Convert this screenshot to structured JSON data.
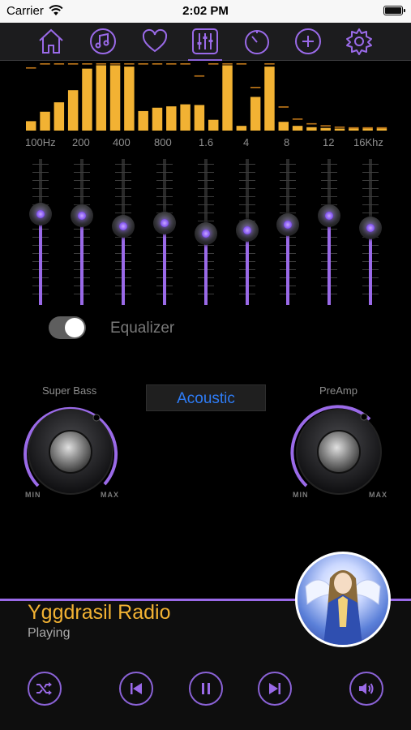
{
  "status_bar": {
    "carrier": "Carrier",
    "time": "2:02 PM"
  },
  "toolbar": {
    "icons": [
      "home-icon",
      "music-note-icon",
      "heart-icon",
      "equalizer-icon",
      "timer-icon",
      "add-icon",
      "gear-icon"
    ],
    "active": "equalizer-icon"
  },
  "spectrum": {
    "bar_levels": [
      0.14,
      0.28,
      0.42,
      0.6,
      0.92,
      0.97,
      0.97,
      0.95,
      0.29,
      0.34,
      0.36,
      0.39,
      0.38,
      0.16,
      0.97,
      0.07,
      0.5,
      0.95,
      0.13,
      0.07,
      0.05,
      0.04,
      0.03,
      0.03,
      0.03,
      0.03
    ],
    "peak_levels": [
      0.94,
      1.0,
      1.0,
      1.0,
      1.0,
      1.0,
      1.0,
      1.0,
      1.0,
      1.0,
      1.0,
      1.0,
      0.82,
      1.0,
      1.0,
      1.0,
      0.65,
      1.0,
      0.36,
      0.18,
      0.11,
      0.08,
      0.06,
      0.05,
      0.05,
      0.05
    ],
    "bar_color": "#f2b233",
    "peak_color": "#c47a1a"
  },
  "frequencies": [
    "100Hz",
    "200",
    "400",
    "800",
    "1.6",
    "4",
    "8",
    "12",
    "16Khz"
  ],
  "sliders": [
    0.62,
    0.61,
    0.54,
    0.56,
    0.49,
    0.51,
    0.55,
    0.61,
    0.53
  ],
  "equalizer_toggle": {
    "label": "Equalizer",
    "on": true
  },
  "super_bass": {
    "label": "Super Bass",
    "min_label": "MIN",
    "max_label": "MAX"
  },
  "preamp": {
    "label": "PreAmp",
    "min_label": "MIN",
    "max_label": "MAX"
  },
  "preset": {
    "label": "Acoustic"
  },
  "now_playing": {
    "station": "Yggdrasil Radio",
    "status": "Playing"
  },
  "controls": [
    "shuffle-icon",
    "previous-icon",
    "pause-icon",
    "next-icon",
    "volume-icon"
  ],
  "accent_color": "#9a6ae8"
}
